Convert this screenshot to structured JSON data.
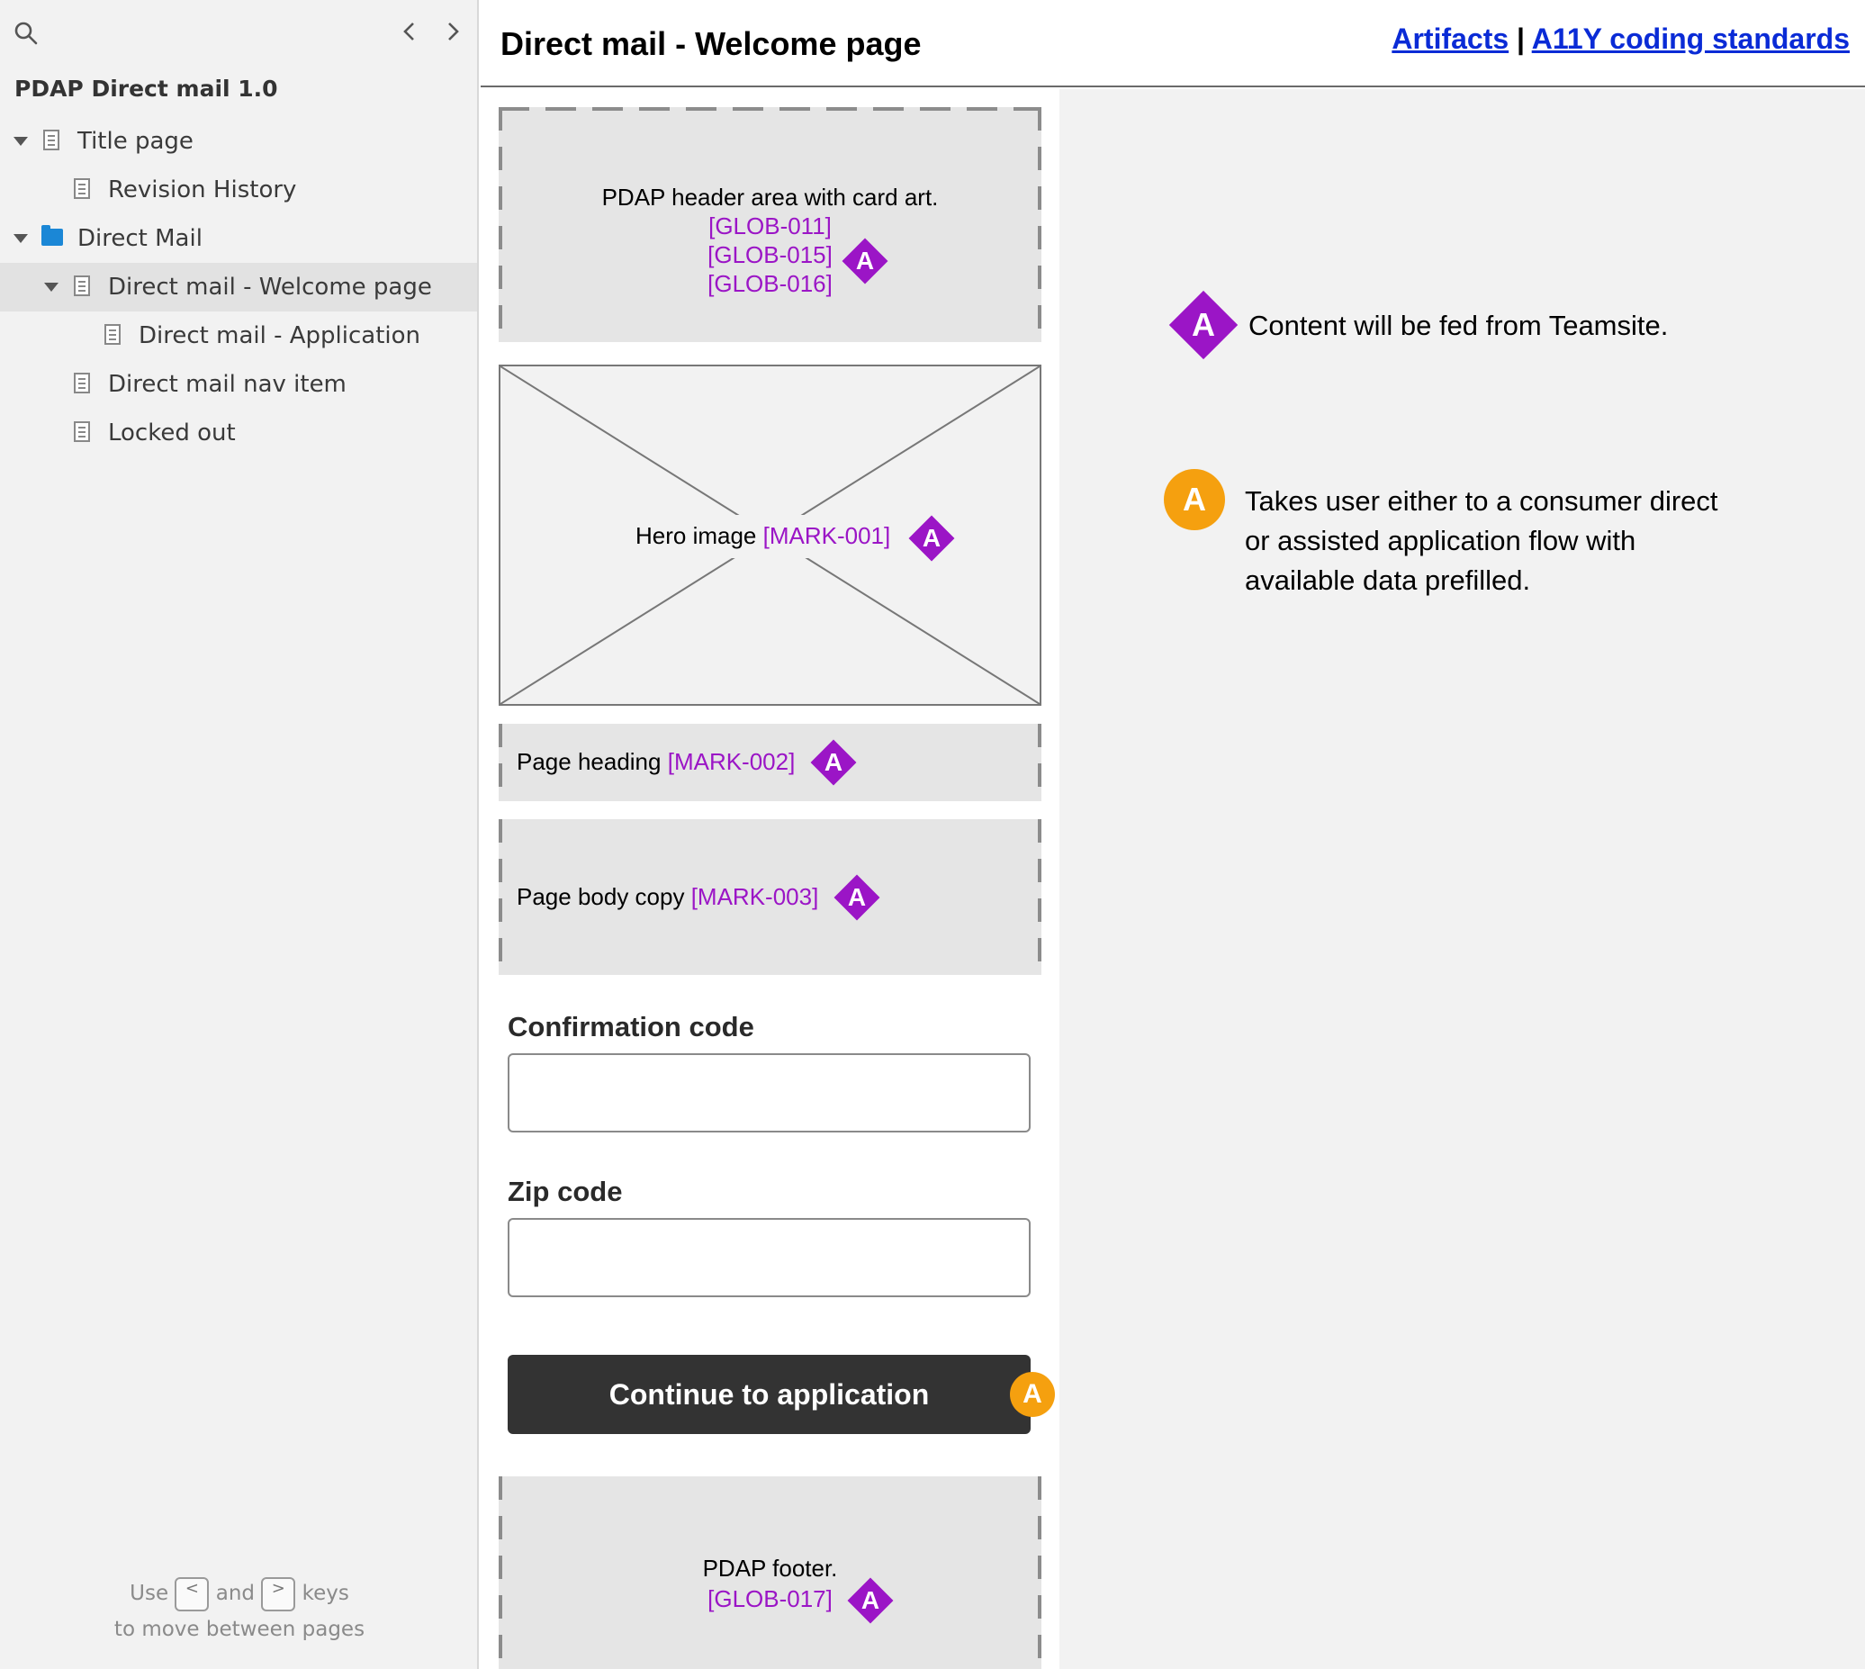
{
  "sidebar": {
    "project_title": "PDAP Direct mail 1.0",
    "items": [
      {
        "label": "Title page"
      },
      {
        "label": "Revision History"
      },
      {
        "label": "Direct Mail"
      },
      {
        "label": "Direct mail - Welcome page"
      },
      {
        "label": "Direct mail - Application"
      },
      {
        "label": "Direct mail nav item"
      },
      {
        "label": "Locked out"
      }
    ],
    "hint": {
      "use": "Use",
      "and": "and",
      "keys": "keys",
      "line2": "to move between pages",
      "key_prev": "<",
      "key_next": ">"
    }
  },
  "header": {
    "title": "Direct mail - Welcome page",
    "links": {
      "artifacts": "Artifacts",
      "separator": "|",
      "a11y": "A11Y coding standards"
    }
  },
  "wireframe": {
    "header_area": {
      "text": "PDAP header area with card art.",
      "codes": [
        "[GLOB-011]",
        "[GLOB-015]",
        "[GLOB-016]"
      ]
    },
    "hero": {
      "text": "Hero image",
      "code": "[MARK-001]"
    },
    "page_heading": {
      "text": "Page heading",
      "code": "[MARK-002]"
    },
    "page_body": {
      "text": "Page body copy",
      "code": "[MARK-003]"
    },
    "confirmation": {
      "label": "Confirmation code",
      "value": ""
    },
    "zip": {
      "label": "Zip code",
      "value": ""
    },
    "continue_button": "Continue to application",
    "footer": {
      "text": "PDAP footer.",
      "code": "[GLOB-017]"
    }
  },
  "badges": {
    "diamond_letter": "A",
    "circle_letter": "A"
  },
  "legend": {
    "diamond_note": "Content will be fed from Teamsite.",
    "circle_note_lines": [
      "Takes user either to a consumer direct",
      "or assisted application flow with",
      "available data prefilled."
    ]
  },
  "colors": {
    "annotation_purple": "#9b15c6",
    "annotation_orange": "#f5a00f",
    "button_dark": "#333333",
    "link_blue": "#0a2bd6",
    "folder_blue": "#1b87d6"
  }
}
